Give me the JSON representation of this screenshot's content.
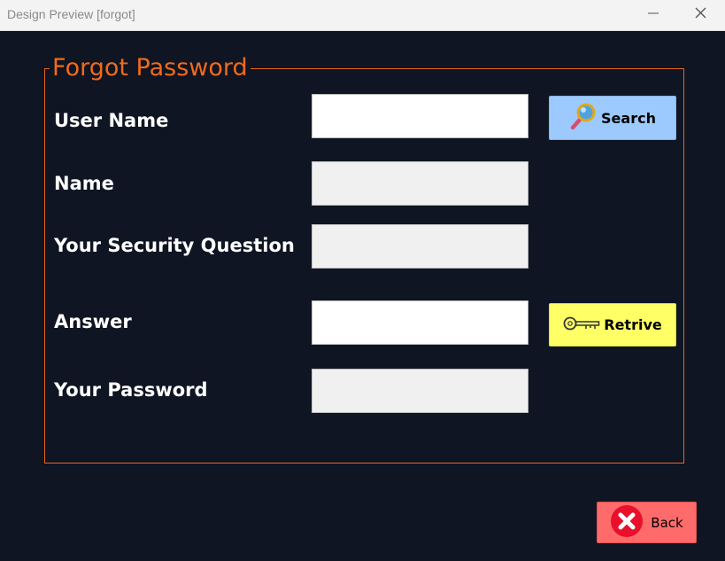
{
  "window": {
    "title": "Design Preview [forgot]"
  },
  "form": {
    "legend": "Forgot Password",
    "fields": {
      "user_name": {
        "label": "User Name",
        "value": ""
      },
      "name": {
        "label": "Name",
        "value": ""
      },
      "security_question": {
        "label": "Your Security Question",
        "value": ""
      },
      "answer": {
        "label": "Answer",
        "value": ""
      },
      "password": {
        "label": "Your Password",
        "value": ""
      }
    }
  },
  "buttons": {
    "search": "Search",
    "retrive": "Retrive",
    "back": "Back"
  },
  "colors": {
    "background": "#0f1522",
    "accent": "#f06a1c",
    "search_button": "#9ccaff",
    "retrive_button": "#ffff66",
    "back_button": "#ff6b6b"
  },
  "icons": {
    "search": "magnifier-icon",
    "retrive": "key-icon",
    "back": "close-circle-icon"
  }
}
